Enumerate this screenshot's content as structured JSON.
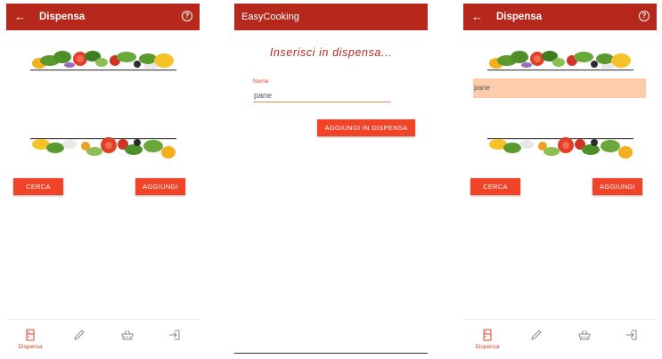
{
  "screen_pantry": {
    "title": "Dispensa",
    "search_button": "CERCA",
    "add_button": "AGGIUNGI"
  },
  "screen_add": {
    "app_title": "EasyCooking",
    "heading": "Inserisci in dispensa...",
    "field_label": "Nome",
    "field_value": "pane",
    "submit_button": "AGGIUNGI IN DISPENSA"
  },
  "screen_pantry_result": {
    "title": "Dispensa",
    "list_item": "pane",
    "search_button": "CERCA",
    "add_button": "AGGIUNGI"
  },
  "bottom_nav": {
    "active_label": "Dispensa",
    "items": [
      "pantry-icon",
      "pencil-icon",
      "basket-icon",
      "logout-icon"
    ]
  },
  "colors": {
    "app_bar": "#b7281c",
    "button": "#f04328",
    "accent": "#e0402a",
    "highlight": "#fdccaa"
  }
}
